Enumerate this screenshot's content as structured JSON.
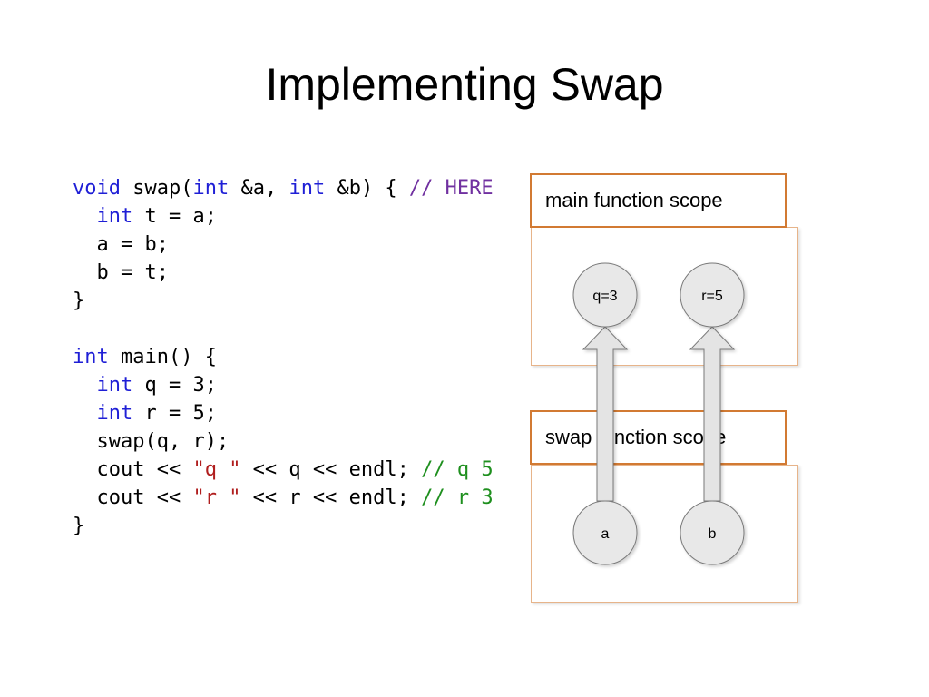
{
  "slide": {
    "title": "Implementing Swap"
  },
  "code": {
    "lines": [
      [
        {
          "t": "void",
          "c": "kw"
        },
        {
          "t": " swap(",
          "c": ""
        },
        {
          "t": "int",
          "c": "kw"
        },
        {
          "t": " &a, ",
          "c": ""
        },
        {
          "t": "int",
          "c": "kw"
        },
        {
          "t": " &b) { ",
          "c": ""
        },
        {
          "t": "// HERE",
          "c": "cm-purple"
        }
      ],
      [
        {
          "t": "  ",
          "c": ""
        },
        {
          "t": "int",
          "c": "kw"
        },
        {
          "t": " t = a;",
          "c": ""
        }
      ],
      [
        {
          "t": "  a = b;",
          "c": ""
        }
      ],
      [
        {
          "t": "  b = t;",
          "c": ""
        }
      ],
      [
        {
          "t": "}",
          "c": ""
        }
      ],
      [
        {
          "t": "",
          "c": ""
        }
      ],
      [
        {
          "t": "int",
          "c": "kw"
        },
        {
          "t": " main() {",
          "c": ""
        }
      ],
      [
        {
          "t": "  ",
          "c": ""
        },
        {
          "t": "int",
          "c": "kw"
        },
        {
          "t": " q = 3;",
          "c": ""
        }
      ],
      [
        {
          "t": "  ",
          "c": ""
        },
        {
          "t": "int",
          "c": "kw"
        },
        {
          "t": " r = 5;",
          "c": ""
        }
      ],
      [
        {
          "t": "  swap(q, r);",
          "c": ""
        }
      ],
      [
        {
          "t": "  cout << ",
          "c": ""
        },
        {
          "t": "\"q \"",
          "c": "str"
        },
        {
          "t": " << q << endl; ",
          "c": ""
        },
        {
          "t": "// q 5",
          "c": "cm-green"
        }
      ],
      [
        {
          "t": "  cout << ",
          "c": ""
        },
        {
          "t": "\"r \"",
          "c": "str"
        },
        {
          "t": " << r << endl; ",
          "c": ""
        },
        {
          "t": "// r 3",
          "c": "cm-green"
        }
      ],
      [
        {
          "t": "}",
          "c": ""
        }
      ]
    ]
  },
  "diagram": {
    "main_scope_label": "main function scope",
    "swap_scope_label": "swap function scope",
    "main_nodes": [
      "q=3",
      "r=5"
    ],
    "swap_nodes": [
      "a",
      "b"
    ],
    "colors": {
      "scope_border": "#d27a33",
      "node_fill": "#e8e8e8",
      "keyword": "#1f1fd6",
      "comment_here": "#7030a0",
      "comment_result": "#1e8f1e",
      "string": "#b01e1e"
    }
  }
}
